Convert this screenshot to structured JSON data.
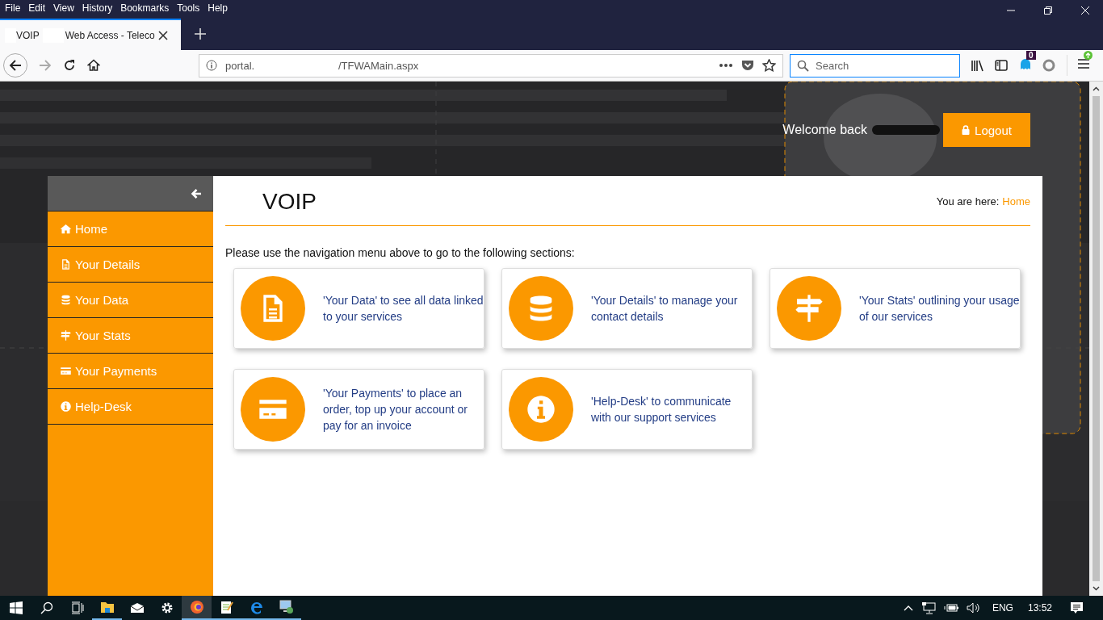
{
  "menu": [
    "File",
    "Edit",
    "View",
    "History",
    "Bookmarks",
    "Tools",
    "Help"
  ],
  "tabs": [
    {
      "title_start": "VOIP",
      "title_end": "Web Access - Teleco",
      "selected": true
    }
  ],
  "address": {
    "start": "portal.",
    "end": "/TFWAMain.aspx"
  },
  "search": {
    "placeholder": "Search"
  },
  "extension_badge": "0",
  "header": {
    "welcome": "Welcome back",
    "logout": "Logout"
  },
  "page_title": "VOIP",
  "breadcrumb": {
    "label": "You are here:",
    "link": "Home"
  },
  "sidebar": {
    "items": [
      {
        "label": "Home",
        "kind": "home",
        "selected": false
      },
      {
        "label": "Your Details",
        "kind": "doc",
        "selected": false
      },
      {
        "label": "Your Data",
        "kind": "database",
        "selected": false
      },
      {
        "label": "Your Stats",
        "kind": "signpost",
        "selected": false
      },
      {
        "label": "Your Payments",
        "kind": "card",
        "selected": false
      },
      {
        "label": "Help-Desk",
        "kind": "info",
        "selected": false
      }
    ]
  },
  "intro": "Please use the navigation menu above to go to the following sections:",
  "cards": [
    {
      "kind": "doc",
      "text": "'Your Data' to see all data linked to your services"
    },
    {
      "kind": "database",
      "text": "'Your Details' to manage your contact details"
    },
    {
      "kind": "signpost",
      "text": "'Your Stats' outlining your usage of our services"
    },
    {
      "kind": "card",
      "text": "'Your Payments' to place an order, top up your account or pay for an invoice"
    },
    {
      "kind": "info",
      "text": "'Help-Desk' to communicate with our support services"
    }
  ],
  "taskbar": {
    "language": "ENG",
    "time": "13:52"
  }
}
